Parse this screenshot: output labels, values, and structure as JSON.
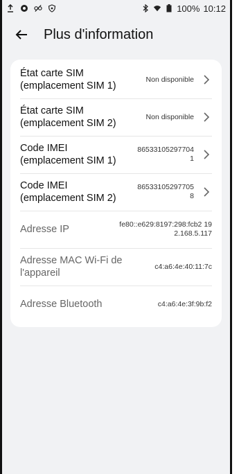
{
  "status_bar": {
    "battery": "100%",
    "time": "10:12"
  },
  "header": {
    "title": "Plus d'information"
  },
  "rows": [
    {
      "label": "État carte SIM (emplacement SIM 1)",
      "value": "Non disponible",
      "chevron": true
    },
    {
      "label": "État carte SIM (emplacement SIM 2)",
      "value": "Non disponible",
      "chevron": true
    },
    {
      "label": "Code IMEI (emplacement SIM 1)",
      "value": "865331052977041",
      "chevron": true
    },
    {
      "label": "Code IMEI (emplacement SIM 2)",
      "value": "865331052977058",
      "chevron": true
    },
    {
      "label": "Adresse IP",
      "value": "fe80::e629:8197:298:fcb2 192.168.5.117",
      "chevron": false
    },
    {
      "label": "Adresse MAC Wi-Fi de l'appareil",
      "value": "c4:a6:4e:40:11:7c",
      "chevron": false
    },
    {
      "label": "Adresse Bluetooth",
      "value": "c4:a6:4e:3f:9b:f2",
      "chevron": false
    }
  ]
}
